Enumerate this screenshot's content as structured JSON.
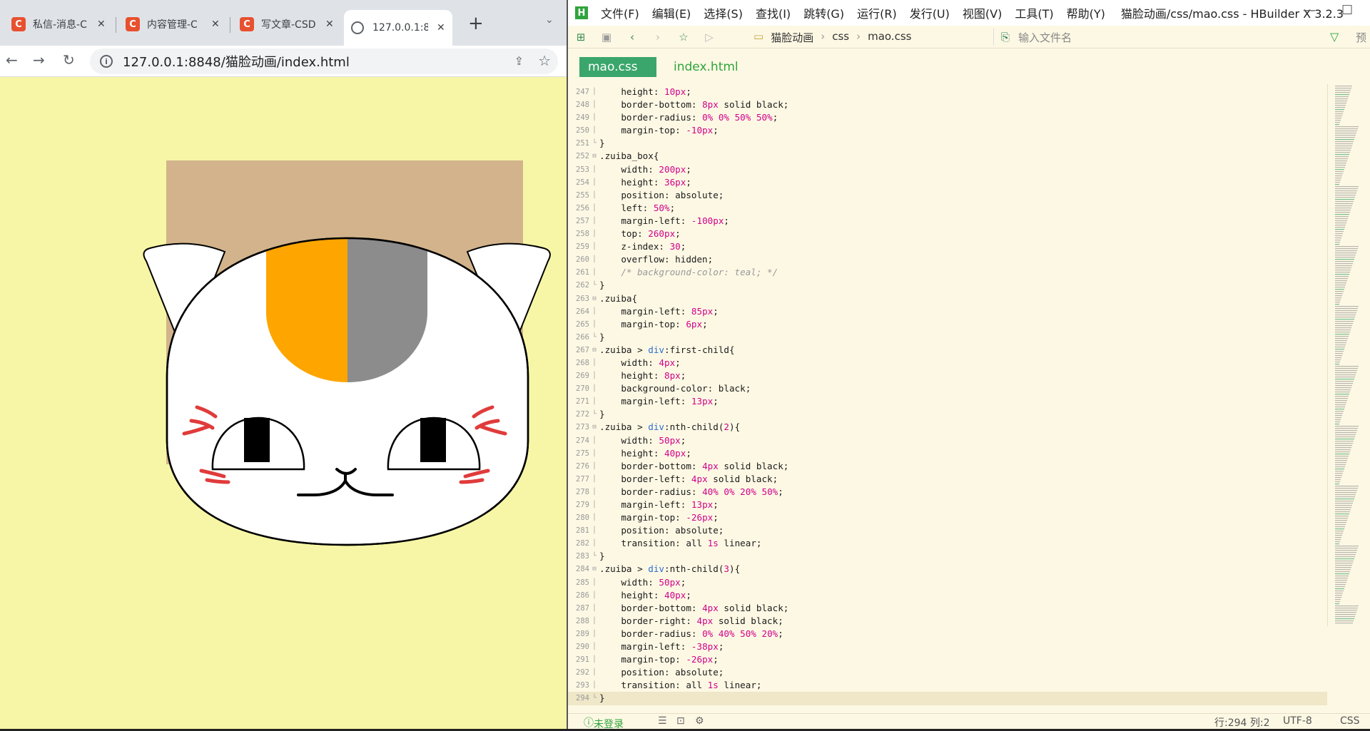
{
  "browser": {
    "tabs": [
      {
        "title": "私信-消息-C",
        "favicon": "C"
      },
      {
        "title": "内容管理-C",
        "favicon": "C"
      },
      {
        "title": "写文章-CSD",
        "favicon": "C"
      },
      {
        "title": "127.0.0.1:8",
        "favicon": "globe"
      }
    ],
    "new_tab": "+",
    "url": "127.0.0.1:8848/猫脸动画/index.html",
    "colors": {
      "page_bg": "#f6f6a6",
      "box_bg": "#d2b38b",
      "orange": "#ffa500",
      "gray": "#8c8c8c"
    }
  },
  "editor": {
    "menu": [
      "文件(F)",
      "编辑(E)",
      "选择(S)",
      "查找(I)",
      "跳转(G)",
      "运行(R)",
      "发行(U)",
      "视图(V)",
      "工具(T)",
      "帮助(Y)"
    ],
    "window_title": "猫脸动画/css/mao.css - HBuilder X 3.2.3",
    "breadcrumbs": [
      "猫脸动画",
      "css",
      "mao.css"
    ],
    "file_search_placeholder": "输入文件名",
    "tabs": [
      "mao.css",
      "index.html"
    ],
    "preview_label": "预",
    "code_lines": [
      {
        "n": "247",
        "t": "    height: 10px;"
      },
      {
        "n": "248",
        "t": "    border-bottom: 8px solid black;"
      },
      {
        "n": "249",
        "t": "    border-radius: 0% 0% 50% 50%;"
      },
      {
        "n": "250",
        "t": "    margin-top: -10px;"
      },
      {
        "n": "251",
        "t": "}"
      },
      {
        "n": "252",
        "t": ".zuiba_box{"
      },
      {
        "n": "253",
        "t": "    width: 200px;"
      },
      {
        "n": "254",
        "t": "    height: 36px;"
      },
      {
        "n": "255",
        "t": "    position: absolute;"
      },
      {
        "n": "256",
        "t": "    left: 50%;"
      },
      {
        "n": "257",
        "t": "    margin-left: -100px;"
      },
      {
        "n": "258",
        "t": "    top: 260px;"
      },
      {
        "n": "259",
        "t": "    z-index: 30;"
      },
      {
        "n": "260",
        "t": "    overflow: hidden;"
      },
      {
        "n": "261",
        "t": "    /* background-color: teal; */"
      },
      {
        "n": "262",
        "t": "}"
      },
      {
        "n": "263",
        "t": ".zuiba{"
      },
      {
        "n": "264",
        "t": "    margin-left: 85px;"
      },
      {
        "n": "265",
        "t": "    margin-top: 6px;"
      },
      {
        "n": "266",
        "t": "}"
      },
      {
        "n": "267",
        "t": ".zuiba > div:first-child{"
      },
      {
        "n": "268",
        "t": "    width: 4px;"
      },
      {
        "n": "269",
        "t": "    height: 8px;"
      },
      {
        "n": "270",
        "t": "    background-color: black;"
      },
      {
        "n": "271",
        "t": "    margin-left: 13px;"
      },
      {
        "n": "272",
        "t": "}"
      },
      {
        "n": "273",
        "t": ".zuiba > div:nth-child(2){"
      },
      {
        "n": "274",
        "t": "    width: 50px;"
      },
      {
        "n": "275",
        "t": "    height: 40px;"
      },
      {
        "n": "276",
        "t": "    border-bottom: 4px solid black;"
      },
      {
        "n": "277",
        "t": "    border-left: 4px solid black;"
      },
      {
        "n": "278",
        "t": "    border-radius: 40% 0% 20% 50%;"
      },
      {
        "n": "279",
        "t": "    margin-left: 13px;"
      },
      {
        "n": "280",
        "t": "    margin-top: -26px;"
      },
      {
        "n": "281",
        "t": "    position: absolute;"
      },
      {
        "n": "282",
        "t": "    transition: all 1s linear;"
      },
      {
        "n": "283",
        "t": "}"
      },
      {
        "n": "284",
        "t": ".zuiba > div:nth-child(3){"
      },
      {
        "n": "285",
        "t": "    width: 50px;"
      },
      {
        "n": "286",
        "t": "    height: 40px;"
      },
      {
        "n": "287",
        "t": "    border-bottom: 4px solid black;"
      },
      {
        "n": "288",
        "t": "    border-right: 4px solid black;"
      },
      {
        "n": "289",
        "t": "    border-radius: 0% 40% 50% 20%;"
      },
      {
        "n": "290",
        "t": "    margin-left: -38px;"
      },
      {
        "n": "291",
        "t": "    margin-top: -26px;"
      },
      {
        "n": "292",
        "t": "    position: absolute;"
      },
      {
        "n": "293",
        "t": "    transition: all 1s linear;"
      },
      {
        "n": "294",
        "t": "}"
      }
    ],
    "status": {
      "login": "未登录",
      "position": "行:294  列:2",
      "encoding": "UTF-8",
      "language": "CSS"
    }
  }
}
